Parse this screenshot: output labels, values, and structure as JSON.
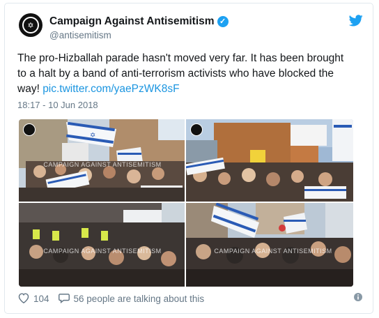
{
  "tweet": {
    "author_name": "Campaign Against Antisemitism",
    "handle": "@antisemitism",
    "text_before_link": "The pro-Hizballah parade hasn't moved very far. It has been brought to a halt by a band of anti-terrorism activists who have blocked the way! ",
    "link": "pic.twitter.com/yaePzWK8sF",
    "timestamp": "18:17 - 10 Jun 2018",
    "photo_watermark": "CAMPAIGN AGAINST ANTISEMITISM",
    "photo1_sign": "",
    "likes": "104",
    "conversation": "56 people are talking about this"
  },
  "colors": {
    "link": "#1b95e0",
    "verified": "#1da1f2",
    "muted": "#657786"
  },
  "icons": [
    "avatar-logo",
    "verified-badge-icon",
    "twitter-bird-icon",
    "heart-icon",
    "reply-icon",
    "info-icon"
  ]
}
